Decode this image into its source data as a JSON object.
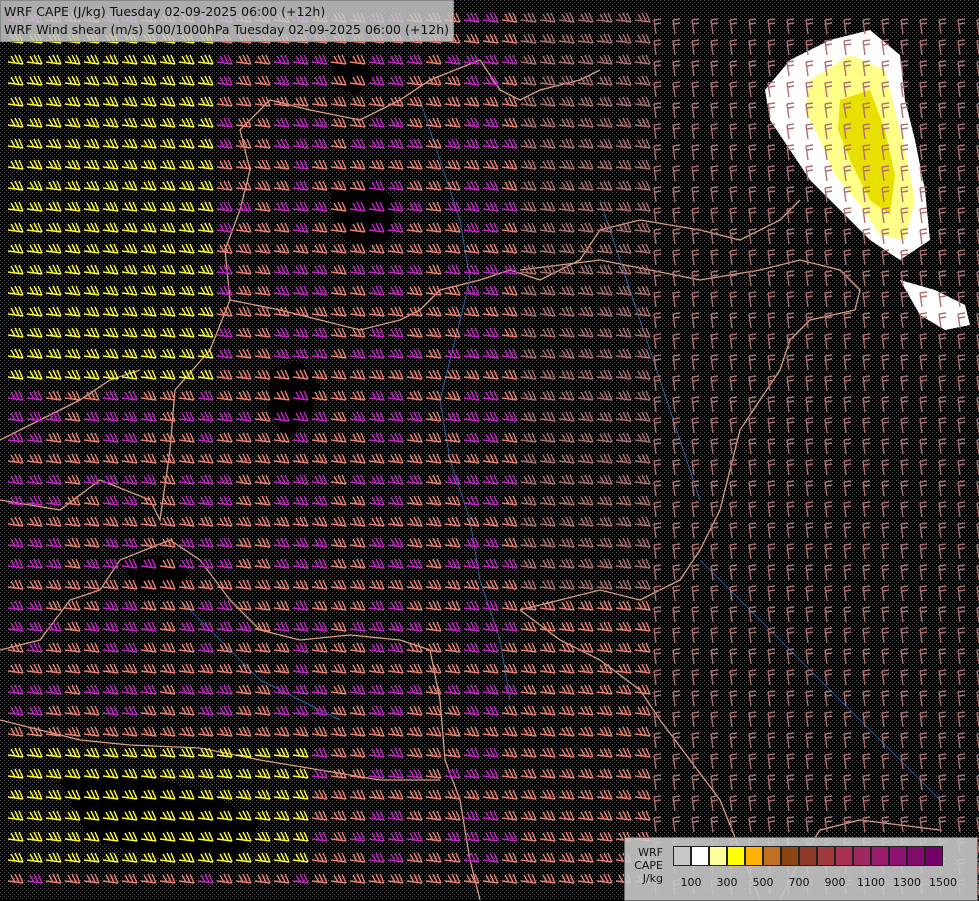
{
  "header": {
    "line1": "WRF CAPE (J/kg) Tuesday 02-09-2025 06:00 (+12h)",
    "line2": "WRF Wind shear (m/s) 500/1000hPa Tuesday 02-09-2025 06:00 (+12h)"
  },
  "legend": {
    "label_line1": "WRF",
    "label_line2": "CAPE",
    "label_line3": "J/kg",
    "ticks": [
      "100",
      "300",
      "500",
      "700",
      "900",
      "1100",
      "1300",
      "1500"
    ],
    "colors": [
      "#c8c8c8",
      "#ffffff",
      "#ffff99",
      "#ffff00",
      "#ffb000",
      "#c07020",
      "#8b4513",
      "#8b3a2a",
      "#a03a3a",
      "#a83050",
      "#a02860",
      "#981c6a",
      "#8c1470",
      "#800a6e",
      "#74006a"
    ]
  },
  "map_colors": {
    "background": "#000000",
    "barb_magenta": "#cc22cc",
    "barb_salmon": "#f08070",
    "barb_brown": "#b07070",
    "barb_yellow": "#ffff33",
    "borders": "#d8a080",
    "rivers": "#3060a0"
  }
}
